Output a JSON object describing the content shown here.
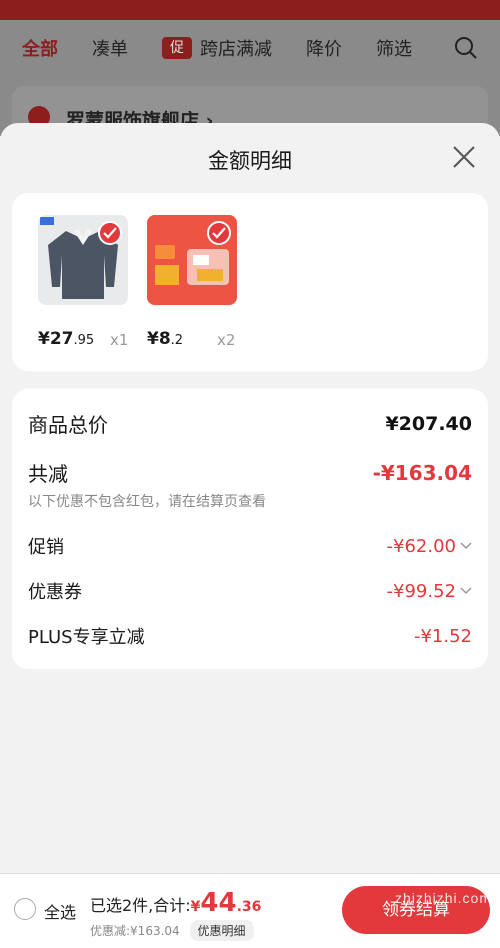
{
  "tabs": {
    "all": "全部",
    "bundle": "凑单",
    "promo_badge": "促",
    "cross_store": "跨店满减",
    "price_drop": "降价",
    "filter": "筛选"
  },
  "store": {
    "name": "罗蒙服饰旗舰店 ›"
  },
  "sheet": {
    "title": "金额明细"
  },
  "products": [
    {
      "price_int": "¥27",
      "price_dec": ".95",
      "qty": "x1"
    },
    {
      "price_int": "¥8",
      "price_dec": ".2",
      "qty": "x2"
    }
  ],
  "details": {
    "total_label": "商品总价",
    "total_value": "¥207.40",
    "reduce_label": "共减",
    "reduce_value": "-¥163.04",
    "note": "以下优惠不包含红包，请在结算页查看",
    "promo_label": "促销",
    "promo_value": "-¥62.00",
    "coupon_label": "优惠券",
    "coupon_value": "-¥99.52",
    "plus_label": "PLUS专享立减",
    "plus_value": "-¥1.52"
  },
  "bottom": {
    "select_all": "全选",
    "selected_text": "已选2件,合计:",
    "currency": "¥",
    "amount_int": "44",
    "amount_dec": ".36",
    "discount_text": "优惠减:¥163.04",
    "detail_chip": "优惠明细",
    "checkout": "领券结算"
  },
  "watermark": "zhizhizhi.com",
  "colors": {
    "accent": "#e4393c",
    "brand_dark": "#8c1e1e"
  }
}
